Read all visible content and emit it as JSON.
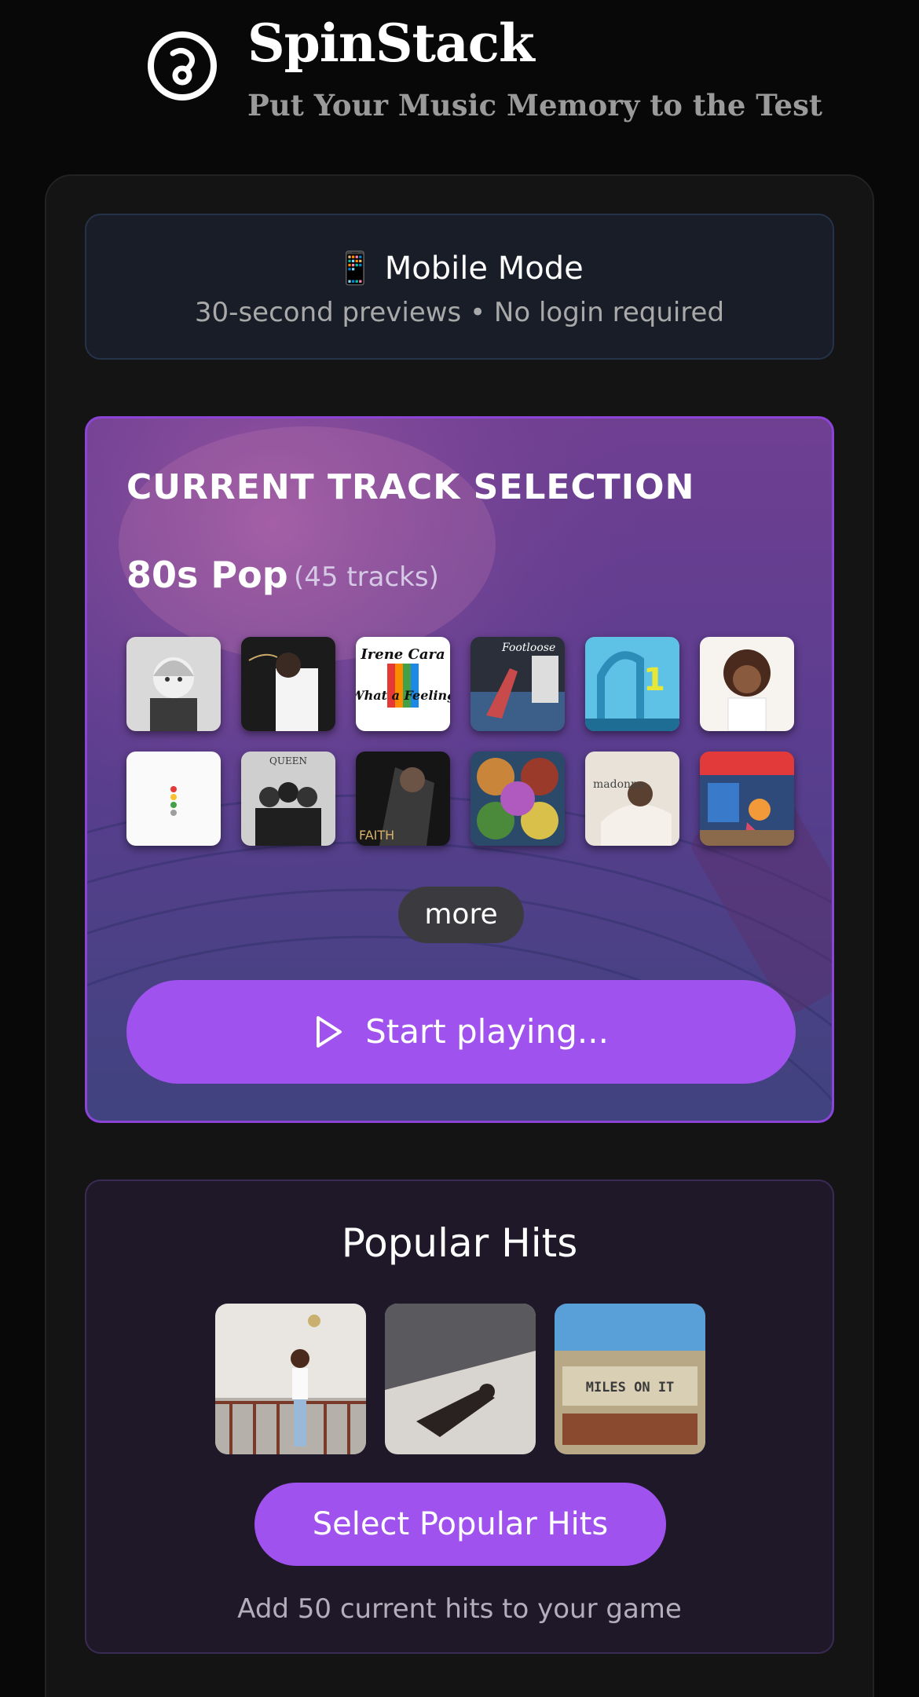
{
  "header": {
    "logo_icon": "disc-icon",
    "title": "SpinStack",
    "subtitle": "Put Your Music Memory to the Test"
  },
  "mobile_banner": {
    "icon": "📱",
    "title": "Mobile Mode",
    "subtitle": "30-second previews • No login required"
  },
  "current_selection": {
    "label": "CURRENT TRACK SELECTION",
    "playlist_name": "80s Pop",
    "track_count": "(45 tracks)",
    "covers": [
      {
        "name": "album-cover-madonna",
        "text": ""
      },
      {
        "name": "album-cover-thriller",
        "text": ""
      },
      {
        "name": "album-cover-irene-cara",
        "text": "Irene Cara"
      },
      {
        "name": "album-cover-footloose",
        "text": ""
      },
      {
        "name": "album-cover-soundtrack-1",
        "text": "1"
      },
      {
        "name": "album-cover-whitney",
        "text": ""
      },
      {
        "name": "album-cover-elton-john",
        "text": ""
      },
      {
        "name": "album-cover-queen",
        "text": "QUEEN"
      },
      {
        "name": "album-cover-faith",
        "text": "FAITH"
      },
      {
        "name": "album-cover-culture-club",
        "text": ""
      },
      {
        "name": "album-cover-like-a-virgin",
        "text": "madonna"
      },
      {
        "name": "album-cover-cyndi-lauper",
        "text": ""
      }
    ],
    "more_label": "more",
    "start_label": "Start playing..."
  },
  "popular_hits": {
    "title": "Popular Hits",
    "button_label": "Select Popular Hits",
    "caption": "Add 50 current hits to your game",
    "covers": [
      {
        "name": "hit-cover-1",
        "text": ""
      },
      {
        "name": "hit-cover-2",
        "text": ""
      },
      {
        "name": "hit-cover-miles-on-it",
        "text": "MILES ON IT"
      }
    ]
  },
  "colors": {
    "background": "#080808",
    "accent": "#a052ee",
    "card_border": "#8b44d6",
    "banner_bg": "#181d27"
  }
}
